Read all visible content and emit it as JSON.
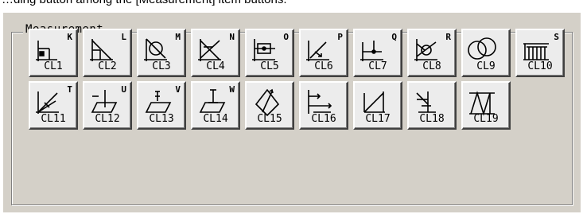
{
  "caption": "…ding button among the [Measurement] item buttons.",
  "group": {
    "legend": "Measurement"
  },
  "buttons": [
    {
      "label": "CL1",
      "corner": "K",
      "icon": "cl1-icon"
    },
    {
      "label": "CL2",
      "corner": "L",
      "icon": "cl2-icon"
    },
    {
      "label": "CL3",
      "corner": "M",
      "icon": "cl3-icon"
    },
    {
      "label": "CL4",
      "corner": "N",
      "icon": "cl4-icon"
    },
    {
      "label": "CL5",
      "corner": "O",
      "icon": "cl5-icon"
    },
    {
      "label": "CL6",
      "corner": "P",
      "icon": "cl6-icon"
    },
    {
      "label": "CL7",
      "corner": "Q",
      "icon": "cl7-icon"
    },
    {
      "label": "CL8",
      "corner": "R",
      "icon": "cl8-icon"
    },
    {
      "label": "CL9",
      "corner": "",
      "icon": "cl9-icon"
    },
    {
      "label": "CL10",
      "corner": "S",
      "icon": "cl10-icon"
    },
    {
      "label": "CL11",
      "corner": "T",
      "icon": "cl11-icon"
    },
    {
      "label": "CL12",
      "corner": "U",
      "icon": "cl12-icon"
    },
    {
      "label": "CL13",
      "corner": "V",
      "icon": "cl13-icon"
    },
    {
      "label": "CL14",
      "corner": "W",
      "icon": "cl14-icon"
    },
    {
      "label": "CL15",
      "corner": "",
      "icon": "cl15-icon"
    },
    {
      "label": "CL16",
      "corner": "",
      "icon": "cl16-icon"
    },
    {
      "label": "CL17",
      "corner": "",
      "icon": "cl17-icon"
    },
    {
      "label": "CL18",
      "corner": "",
      "icon": "cl18-icon"
    },
    {
      "label": "CL19",
      "corner": "",
      "icon": "cl19-icon"
    }
  ]
}
